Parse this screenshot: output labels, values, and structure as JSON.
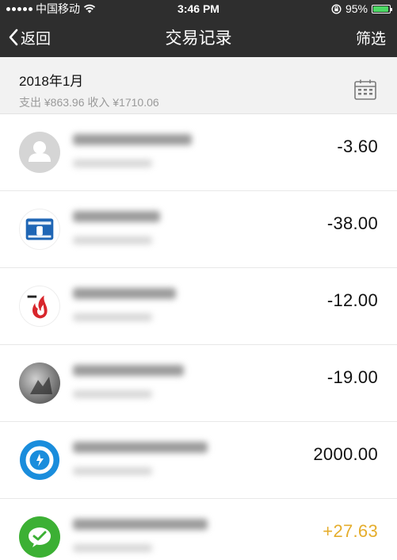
{
  "status": {
    "carrier": "中国移动",
    "time": "3:46 PM",
    "battery_pct": "95%",
    "battery_level": 0.95
  },
  "nav": {
    "back_label": "返回",
    "title": "交易记录",
    "filter_label": "筛选"
  },
  "month": {
    "title": "2018年1月",
    "summary": "支出 ¥863.96 收入 ¥1710.06"
  },
  "transactions": [
    {
      "amount": "-3.60",
      "avatar": "default-user-avatar",
      "type": "expense"
    },
    {
      "amount": "-38.00",
      "avatar": "lawson-station-logo",
      "type": "expense"
    },
    {
      "amount": "-12.00",
      "avatar": "ershuohuo-flame-logo",
      "type": "expense"
    },
    {
      "amount": "-19.00",
      "avatar": "user-photo-avatar",
      "type": "expense"
    },
    {
      "amount": "2000.00",
      "avatar": "blue-finance-logo",
      "type": "neutral"
    },
    {
      "amount": "+27.63",
      "avatar": "wechat-pay-logo",
      "type": "income"
    }
  ],
  "colors": {
    "header_bg": "#2e2e2e",
    "income": "#e5ad2c",
    "battery": "#4cd964"
  }
}
